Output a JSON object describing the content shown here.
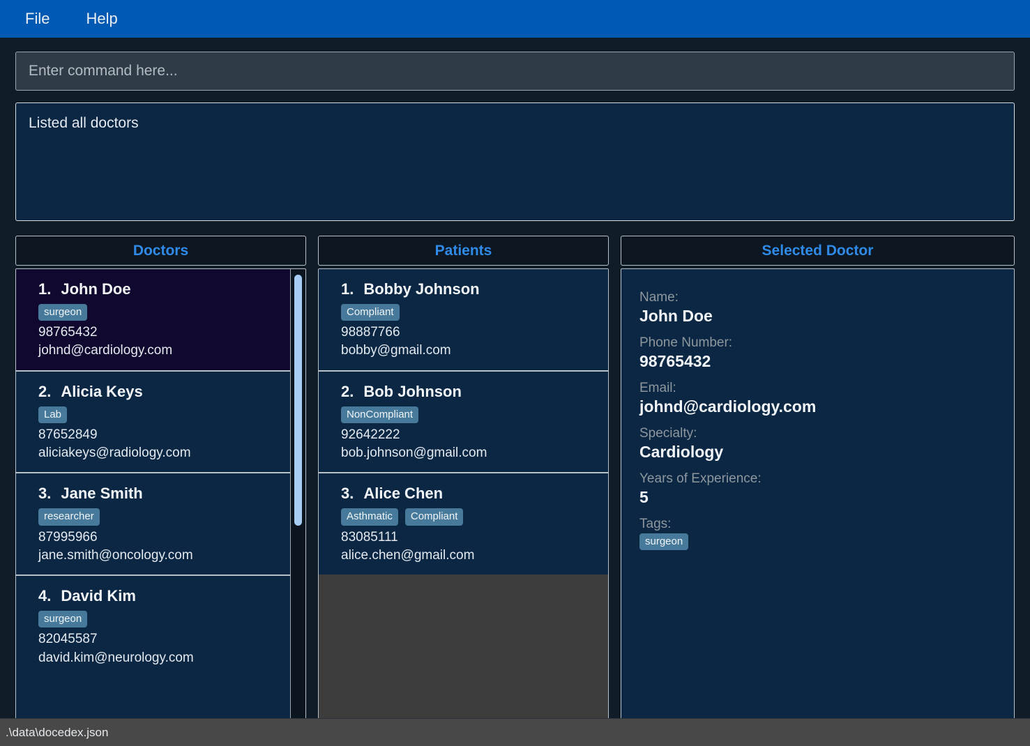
{
  "menu": {
    "items": [
      {
        "label": "File",
        "name": "menu-file"
      },
      {
        "label": "Help",
        "name": "menu-help"
      }
    ]
  },
  "command": {
    "placeholder": "Enter command here...",
    "value": ""
  },
  "result": {
    "text": "Listed all doctors"
  },
  "panels": {
    "doctors": {
      "title": "Doctors",
      "items": [
        {
          "index": "1.",
          "name": "John Doe",
          "tags": [
            "surgeon"
          ],
          "phone": "98765432",
          "email": "johnd@cardiology.com",
          "selected": true
        },
        {
          "index": "2.",
          "name": "Alicia Keys",
          "tags": [
            "Lab"
          ],
          "phone": "87652849",
          "email": "aliciakeys@radiology.com",
          "selected": false
        },
        {
          "index": "3.",
          "name": "Jane Smith",
          "tags": [
            "researcher"
          ],
          "phone": "87995966",
          "email": "jane.smith@oncology.com",
          "selected": false
        },
        {
          "index": "4.",
          "name": "David Kim",
          "tags": [
            "surgeon"
          ],
          "phone": "82045587",
          "email": "david.kim@neurology.com",
          "selected": false
        }
      ]
    },
    "patients": {
      "title": "Patients",
      "items": [
        {
          "index": "1.",
          "name": "Bobby Johnson",
          "tags": [
            "Compliant"
          ],
          "phone": "98887766",
          "email": "bobby@gmail.com",
          "selected": false
        },
        {
          "index": "2.",
          "name": "Bob Johnson",
          "tags": [
            "NonCompliant"
          ],
          "phone": "92642222",
          "email": "bob.johnson@gmail.com",
          "selected": false
        },
        {
          "index": "3.",
          "name": "Alice Chen",
          "tags": [
            "Asthmatic",
            "Compliant"
          ],
          "phone": "83085111",
          "email": "alice.chen@gmail.com",
          "selected": false
        }
      ]
    },
    "selected_doctor": {
      "title": "Selected Doctor",
      "fields": [
        {
          "label": "Name:",
          "value": "John Doe"
        },
        {
          "label": "Phone Number:",
          "value": "98765432"
        },
        {
          "label": "Email:",
          "value": "johnd@cardiology.com"
        },
        {
          "label": "Specialty:",
          "value": "Cardiology"
        },
        {
          "label": "Years of Experience:",
          "value": "5"
        }
      ],
      "tags_label": "Tags:",
      "tags": [
        "surgeon"
      ]
    }
  },
  "statusbar": {
    "path": ".\\data\\docedex.json"
  },
  "colors": {
    "menubar": "#0059b3",
    "root_background": "#101c28",
    "panel_title": "#2f8ae8",
    "tag_background": "#46799a",
    "card_background": "#0b2744",
    "card_selected_background": "#10082e",
    "command_background": "#2f3b47",
    "result_background": "#0b2744",
    "scrollbar_thumb": "#a8cdf5",
    "statusbar_background": "#484848",
    "empty_list_background": "#3d3d3d"
  }
}
